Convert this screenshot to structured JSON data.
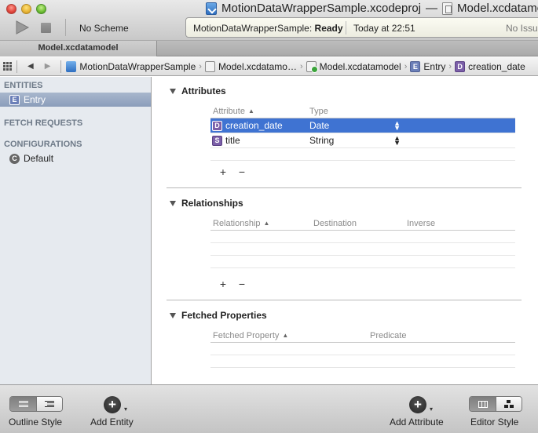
{
  "window": {
    "project_title": "MotionDataWrapperSample.xcodeproj",
    "title_separator": "—",
    "file_title": "Model.xcdatamodel"
  },
  "toolbar": {
    "scheme_label": "No Scheme",
    "status_project": "MotionDataWrapperSample:",
    "status_state": "Ready",
    "status_time": "Today at 22:51",
    "issues": "No Issues"
  },
  "tab": {
    "label": "Model.xcdatamodel"
  },
  "jumpbar": {
    "crumbs": [
      {
        "label": "MotionDataWrapperSample",
        "icon": "xcode-project-icon"
      },
      {
        "label": "Model.xcdatamo…",
        "icon": "folder-icon"
      },
      {
        "label": "Model.xcdatamodel",
        "icon": "data-model-icon"
      },
      {
        "label": "Entry",
        "icon": "entity-icon",
        "badge": "E"
      },
      {
        "label": "creation_date",
        "icon": "attribute-date-icon",
        "badge": "D"
      }
    ]
  },
  "sidebar": {
    "entities_header": "ENTITIES",
    "entities": [
      {
        "label": "Entry",
        "badge": "E"
      }
    ],
    "fetch_header": "FETCH REQUESTS",
    "config_header": "CONFIGURATIONS",
    "configurations": [
      {
        "label": "Default",
        "badge": "C"
      }
    ]
  },
  "attributes": {
    "title": "Attributes",
    "col_attribute": "Attribute",
    "col_type": "Type",
    "rows": [
      {
        "badge": "D",
        "name": "creation_date",
        "type": "Date"
      },
      {
        "badge": "S",
        "name": "title",
        "type": "String"
      }
    ],
    "add": "+",
    "remove": "−"
  },
  "relationships": {
    "title": "Relationships",
    "col_relationship": "Relationship",
    "col_destination": "Destination",
    "col_inverse": "Inverse",
    "add": "+",
    "remove": "−"
  },
  "fetched": {
    "title": "Fetched Properties",
    "col_property": "Fetched Property",
    "col_predicate": "Predicate"
  },
  "bottombar": {
    "outline_style_label": "Outline Style",
    "add_entity_label": "Add Entity",
    "add_attribute_label": "Add Attribute",
    "editor_style_label": "Editor Style",
    "plus": "+"
  },
  "colors": {
    "selection": "#3f73d2",
    "sidebar_bg": "#e6eaef",
    "sidebar_selection": "#8b9dba"
  }
}
